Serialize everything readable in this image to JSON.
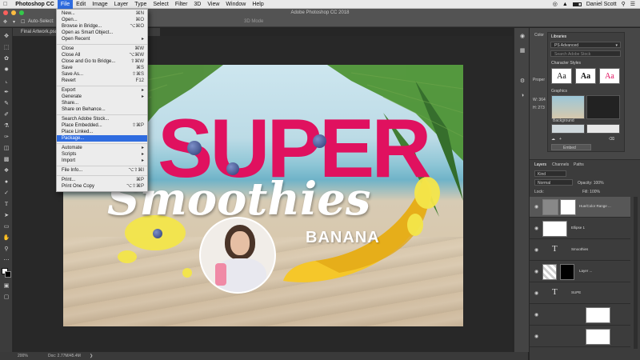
{
  "menubar": {
    "apple": "",
    "app_name": "Photoshop CC",
    "items": [
      "File",
      "Edit",
      "Image",
      "Layer",
      "Type",
      "Select",
      "Filter",
      "3D",
      "View",
      "Window",
      "Help"
    ],
    "active_item": "File",
    "user_name": "Daniel Scott"
  },
  "window": {
    "title": "Adobe Photoshop CC 2018"
  },
  "options": {
    "auto_select": "Auto-Select:",
    "mode_3d": "3D Mode"
  },
  "document": {
    "tab_title": "Final Artwork.psd @ 66.7% (RGB/8#) *",
    "zoom": "200%",
    "doc_size": "Doc: 2.77M/45.4M"
  },
  "file_menu": {
    "items": [
      {
        "label": "New...",
        "shortcut": "⌘N"
      },
      {
        "label": "Open...",
        "shortcut": "⌘O"
      },
      {
        "label": "Browse in Bridge...",
        "shortcut": "⌥⌘O"
      },
      {
        "label": "Open as Smart Object...",
        "shortcut": ""
      },
      {
        "label": "Open Recent",
        "shortcut": "▸"
      },
      {
        "label": "Close",
        "shortcut": "⌘W"
      },
      {
        "label": "Close All",
        "shortcut": "⌥⌘W"
      },
      {
        "label": "Close and Go to Bridge...",
        "shortcut": "⇧⌘W"
      },
      {
        "label": "Save",
        "shortcut": "⌘S"
      },
      {
        "label": "Save As...",
        "shortcut": "⇧⌘S"
      },
      {
        "label": "Revert",
        "shortcut": "F12"
      },
      {
        "label": "Export",
        "shortcut": "▸"
      },
      {
        "label": "Generate",
        "shortcut": "▸"
      },
      {
        "label": "Share...",
        "shortcut": ""
      },
      {
        "label": "Share on Behance...",
        "shortcut": ""
      },
      {
        "label": "Search Adobe Stock...",
        "shortcut": ""
      },
      {
        "label": "Place Embedded...",
        "shortcut": "⇧⌘P"
      },
      {
        "label": "Place Linked...",
        "shortcut": ""
      },
      {
        "label": "Package...",
        "shortcut": ""
      },
      {
        "label": "Automate",
        "shortcut": "▸"
      },
      {
        "label": "Scripts",
        "shortcut": "▸"
      },
      {
        "label": "Import",
        "shortcut": "▸"
      },
      {
        "label": "File Info...",
        "shortcut": "⌥⇧⌘I"
      },
      {
        "label": "Print...",
        "shortcut": "⌘P"
      },
      {
        "label": "Print One Copy",
        "shortcut": "⌥⇧⌘P"
      }
    ],
    "highlighted": "Package..."
  },
  "artwork": {
    "headline": "SUPER",
    "script_word": "Smoothies",
    "flavor": "BANANA"
  },
  "colors": {
    "menu_highlight": "#2f6ce0",
    "headline_pink": "#e0115f",
    "panel_bg": "#474747"
  },
  "libraries_panel": {
    "tab_color": "Color",
    "tab_libraries": "Libraries",
    "library_name": "PS Advanced",
    "search_placeholder": "Search Adobe Stock",
    "character_styles": "Character Styles",
    "style_sample": "Aa",
    "graphics": "Graphics",
    "background_label": "Background",
    "embed_button": "Embed"
  },
  "properties_panel": {
    "tab": "Proper",
    "w_label": "W: 364",
    "h_label": "H: 273"
  },
  "layers_panel": {
    "tabs": [
      "Layers",
      "Channels",
      "Paths"
    ],
    "kind_filter": "Kind",
    "blend_mode": "Normal",
    "opacity": "Opacity: 100%",
    "lock": "Lock:",
    "fill": "Fill: 100%",
    "layers": [
      {
        "name": "Hue/Color Range ...",
        "type": "adjustment"
      },
      {
        "name": "Ellipse 1",
        "type": "shape"
      },
      {
        "name": "Smoothies",
        "type": "text"
      },
      {
        "name": "Layer ...",
        "type": "masked"
      },
      {
        "name": "SUPE",
        "type": "text"
      },
      {
        "name": "",
        "type": "image"
      },
      {
        "name": "",
        "type": "image"
      }
    ]
  }
}
